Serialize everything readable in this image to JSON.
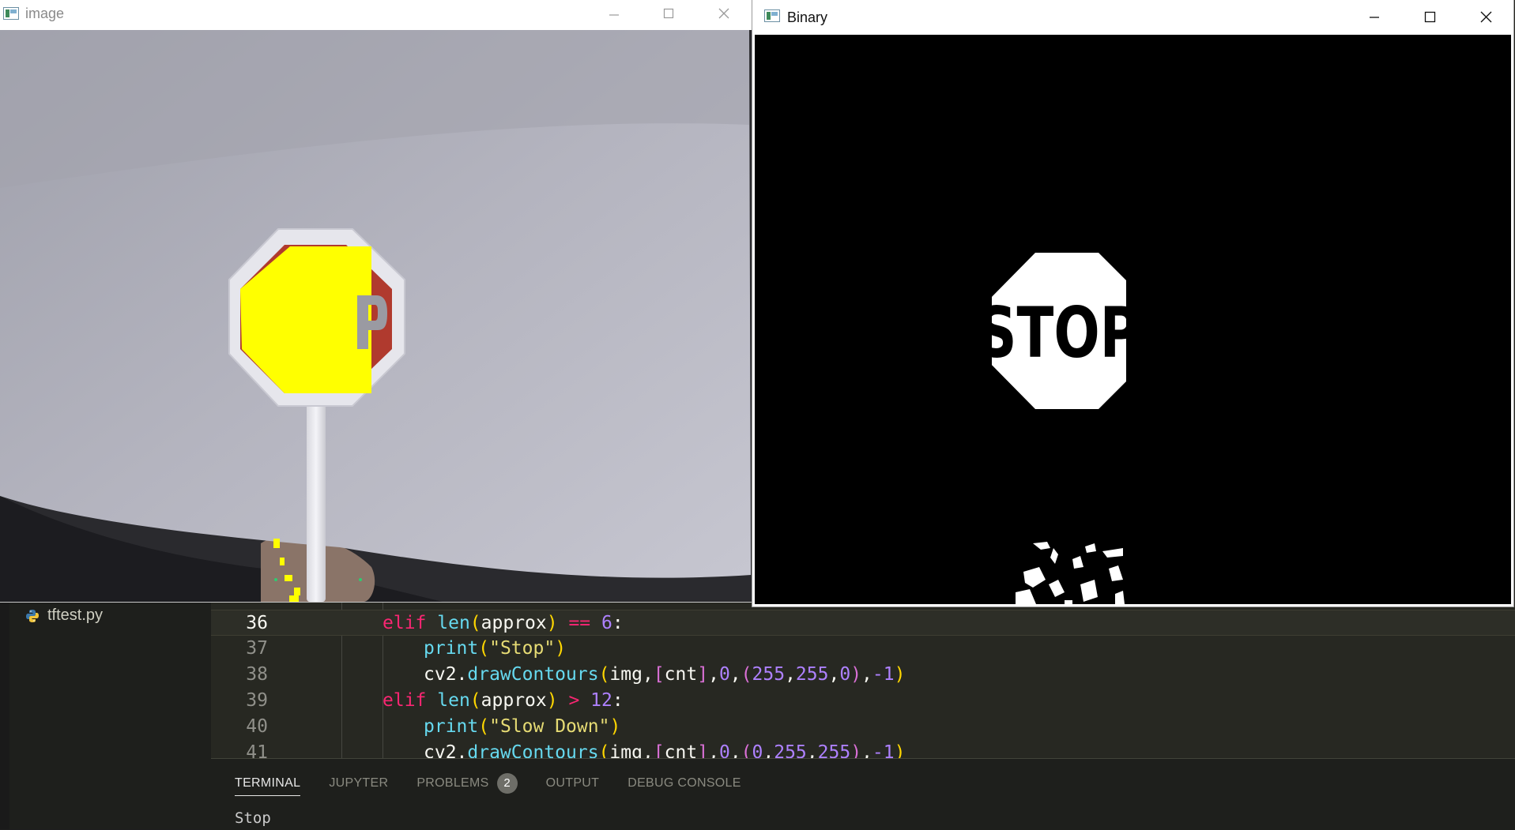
{
  "vscode": {
    "explorer": {
      "file_name": "tftest.py"
    },
    "code_lines": [
      {
        "number": "36",
        "active": true,
        "tokens": [
          {
            "t": "elif ",
            "c": "kw"
          },
          {
            "t": "len",
            "c": "fn"
          },
          {
            "t": "(",
            "c": "b1"
          },
          {
            "t": "approx",
            "c": "pl"
          },
          {
            "t": ")",
            "c": "b1"
          },
          {
            "t": " == ",
            "c": "op"
          },
          {
            "t": "6",
            "c": "num"
          },
          {
            "t": ":",
            "c": "pl"
          }
        ]
      },
      {
        "number": "37",
        "active": false,
        "tokens": [
          {
            "t": "print",
            "c": "fn"
          },
          {
            "t": "(",
            "c": "b1"
          },
          {
            "t": "\"Stop\"",
            "c": "str"
          },
          {
            "t": ")",
            "c": "b1"
          }
        ]
      },
      {
        "number": "38",
        "active": false,
        "tokens": [
          {
            "t": "cv2.",
            "c": "pl"
          },
          {
            "t": "drawContours",
            "c": "fn"
          },
          {
            "t": "(",
            "c": "b1"
          },
          {
            "t": "img,",
            "c": "pl"
          },
          {
            "t": "[",
            "c": "b2"
          },
          {
            "t": "cnt",
            "c": "pl"
          },
          {
            "t": "]",
            "c": "b2"
          },
          {
            "t": ",",
            "c": "pl"
          },
          {
            "t": "0",
            "c": "num"
          },
          {
            "t": ",",
            "c": "pl"
          },
          {
            "t": "(",
            "c": "b2"
          },
          {
            "t": "255",
            "c": "num"
          },
          {
            "t": ",",
            "c": "pl"
          },
          {
            "t": "255",
            "c": "num"
          },
          {
            "t": ",",
            "c": "pl"
          },
          {
            "t": "0",
            "c": "num"
          },
          {
            "t": ")",
            "c": "b2"
          },
          {
            "t": ",",
            "c": "pl"
          },
          {
            "t": "-1",
            "c": "num"
          },
          {
            "t": ")",
            "c": "b1"
          }
        ]
      },
      {
        "number": "39",
        "active": false,
        "tokens": [
          {
            "t": "elif ",
            "c": "kw"
          },
          {
            "t": "len",
            "c": "fn"
          },
          {
            "t": "(",
            "c": "b1"
          },
          {
            "t": "approx",
            "c": "pl"
          },
          {
            "t": ")",
            "c": "b1"
          },
          {
            "t": " > ",
            "c": "op"
          },
          {
            "t": "12",
            "c": "num"
          },
          {
            "t": ":",
            "c": "pl"
          }
        ]
      },
      {
        "number": "40",
        "active": false,
        "tokens": [
          {
            "t": "print",
            "c": "fn"
          },
          {
            "t": "(",
            "c": "b1"
          },
          {
            "t": "\"Slow Down\"",
            "c": "str"
          },
          {
            "t": ")",
            "c": "b1"
          }
        ]
      },
      {
        "number": "41",
        "active": false,
        "tokens": [
          {
            "t": "cv2.",
            "c": "pl"
          },
          {
            "t": "drawContours",
            "c": "fn"
          },
          {
            "t": "(",
            "c": "b1"
          },
          {
            "t": "img,",
            "c": "pl"
          },
          {
            "t": "[",
            "c": "b2"
          },
          {
            "t": "cnt",
            "c": "pl"
          },
          {
            "t": "]",
            "c": "b2"
          },
          {
            "t": ",",
            "c": "pl"
          },
          {
            "t": "0",
            "c": "num"
          },
          {
            "t": ",",
            "c": "pl"
          },
          {
            "t": "(",
            "c": "b2"
          },
          {
            "t": "0",
            "c": "num"
          },
          {
            "t": ",",
            "c": "pl"
          },
          {
            "t": "255",
            "c": "num"
          },
          {
            "t": ",",
            "c": "pl"
          },
          {
            "t": "255",
            "c": "num"
          },
          {
            "t": ")",
            "c": "b2"
          },
          {
            "t": ",",
            "c": "pl"
          },
          {
            "t": "-1",
            "c": "num"
          },
          {
            "t": ")",
            "c": "b1"
          }
        ]
      }
    ],
    "panel": {
      "tabs": [
        {
          "label": "TERMINAL",
          "active": true
        },
        {
          "label": "JUPYTER",
          "active": false
        },
        {
          "label": "PROBLEMS",
          "active": false,
          "badge": "2"
        },
        {
          "label": "OUTPUT",
          "active": false
        },
        {
          "label": "DEBUG CONSOLE",
          "active": false
        }
      ],
      "terminal_output": "Stop"
    }
  },
  "windows": {
    "image": {
      "title": "image",
      "icon": "opencv-window-icon"
    },
    "binary": {
      "title": "Binary",
      "icon": "opencv-window-icon",
      "sign_text": "STOP"
    }
  },
  "colors": {
    "detected_fill": "#ffff00",
    "sign_red": "#b03a2e",
    "binary_background": "#000000",
    "binary_foreground": "#ffffff"
  }
}
